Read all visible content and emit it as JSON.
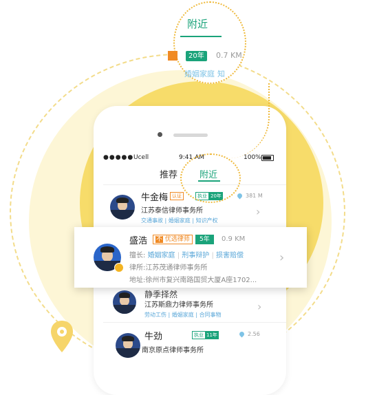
{
  "magnifier": {
    "tab": "附近",
    "badge_years": "20年",
    "distance": "0.7 KM",
    "tag_a": "婚姻家庭",
    "tag_b": "知"
  },
  "status_bar": {
    "carrier": "Ucell",
    "time": "9:41 AM",
    "battery": "100%"
  },
  "tabs": {
    "recommended": "推荐",
    "nearby": "附近"
  },
  "lawyers": [
    {
      "name": "牛金梅",
      "cert": "认证",
      "license": "执业",
      "years": "20年",
      "distance": "381 M",
      "firm": "江苏泰信律师事务所",
      "tags": [
        "交通事故",
        "婚姻家庭",
        "知识产权"
      ]
    },
    {
      "name": "盛浩",
      "badge": "优选律师",
      "years": "5年",
      "distance": "0.9 KM",
      "specialty_label": "擅长:",
      "specialties": [
        "婚姻家庭",
        "刑事辩护",
        "损害赔偿"
      ],
      "firm_label": "律所:",
      "firm": "江苏茂通律师事务所",
      "address_label": "地址:",
      "address": "徐州市复兴南路国贸大厦A座1702..."
    },
    {
      "name": "静季择然",
      "firm": "江苏斯鼎力律师事务所",
      "tags": [
        "劳动工伤",
        "婚姻家庭",
        "合同事物"
      ]
    },
    {
      "name": "牛劲",
      "license": "执业",
      "years": "11年",
      "distance": "2.56",
      "firm": "南京原点律师事务所"
    }
  ],
  "icons": {
    "chevron": "chevron-right-icon",
    "pin": "map-pin-icon",
    "location": "location-icon"
  },
  "colors": {
    "accent_green": "#1aa37a",
    "accent_orange": "#f08a24",
    "tag_blue": "#5aa7d8",
    "disc_yellow": "#f7dc6a"
  }
}
